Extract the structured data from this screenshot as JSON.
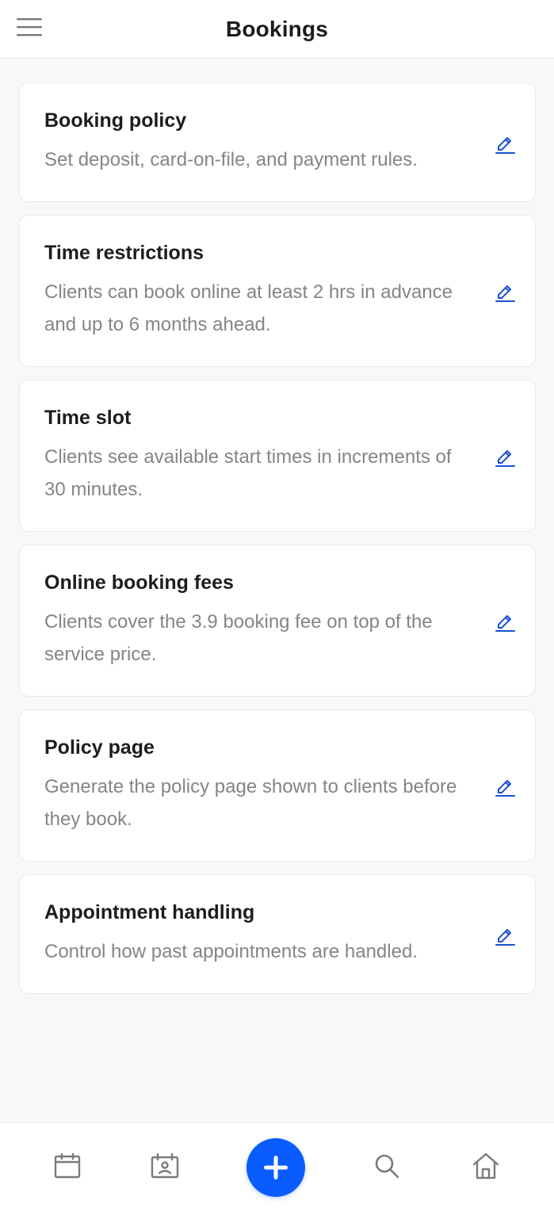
{
  "header": {
    "title": "Bookings",
    "menu_icon": "hamburger-menu-icon"
  },
  "cards": [
    {
      "title": "Booking policy",
      "description": "Set deposit, card-on-file, and payment rules.",
      "action_icon": "edit-pencil-icon"
    },
    {
      "title": "Time restrictions",
      "description": "Clients can book online at least 2 hrs in advance and up to 6 months ahead.",
      "action_icon": "edit-pencil-icon"
    },
    {
      "title": "Time slot",
      "description": "Clients see available start times in increments of 30 minutes.",
      "action_icon": "edit-pencil-icon"
    },
    {
      "title": "Online booking fees",
      "description": "Clients cover the 3.9 booking fee on top of the service price.",
      "action_icon": "edit-pencil-icon"
    },
    {
      "title": "Policy page",
      "description": "Generate the policy page shown to clients before they book.",
      "action_icon": "edit-pencil-icon"
    },
    {
      "title": "Appointment handling",
      "description": "Control how past appointments are handled.",
      "action_icon": "edit-pencil-icon"
    }
  ],
  "bottom_nav": {
    "items": [
      {
        "icon": "calendar-icon"
      },
      {
        "icon": "client-calendar-icon"
      },
      {
        "icon": "plus-icon"
      },
      {
        "icon": "search-icon"
      },
      {
        "icon": "home-icon"
      }
    ]
  },
  "colors": {
    "accent": "#0a5cff",
    "edit_icon": "#1a4fd6",
    "background": "#f8f8f8",
    "card": "#ffffff",
    "title_text": "#1d1d1d",
    "secondary_text": "#858585",
    "nav_icon": "#7a7a7a"
  }
}
